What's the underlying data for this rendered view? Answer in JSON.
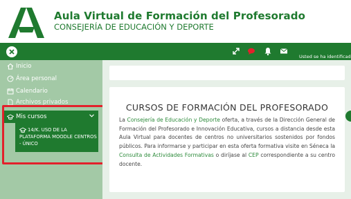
{
  "header": {
    "title": "Aula Virtual de Formación del Profesorado",
    "subtitle": "CONSEJERÍA DE EDUCACIÓN Y DEPORTE",
    "logo_icon": "junta-andalucia-logo",
    "brand_color": "#1f7a2f"
  },
  "topbar": {
    "user_text": "Usted se ha identificado",
    "icons": [
      "close-icon",
      "fullscreen-icon",
      "chat-icon",
      "bell-icon",
      "envelope-icon"
    ],
    "notification_color": "#e3202b"
  },
  "sidebar": {
    "items": [
      {
        "label": "Inicio",
        "icon": "home-icon"
      },
      {
        "label": "Área personal",
        "icon": "dashboard-icon"
      },
      {
        "label": "Calendario",
        "icon": "calendar-icon"
      },
      {
        "label": "Archivos privados",
        "icon": "file-icon"
      }
    ],
    "mis_cursos": {
      "label": "Mis cursos",
      "icon": "graduation-cap-icon"
    },
    "course": {
      "label": "14/K. USO DE LA PLATAFORMA MOODLE CENTROS - ÚNICO",
      "icon": "graduation-cap-icon"
    },
    "highlight_color": "#e3202b"
  },
  "main": {
    "card_title": "CURSOS DE FORMACIÓN DEL PROFESORADO",
    "para": {
      "t1": "La ",
      "l1": "Consejería de Educación y Deporte",
      "t2": " oferta, a través de la Dirección General de Formación del Profesorado e Innovación Educativa, cursos a distancia desde esta Aula Virtual para docentes de centros no universitarios sostenidos por fondos públicos. Para informarse y participar en esta oferta formativa visite en Séneca la ",
      "l2": "Consulta de Actividades Formativas",
      "t3": " o diríjase al ",
      "l3": "CEP",
      "t4": " correspondiente a su centro docente."
    }
  }
}
